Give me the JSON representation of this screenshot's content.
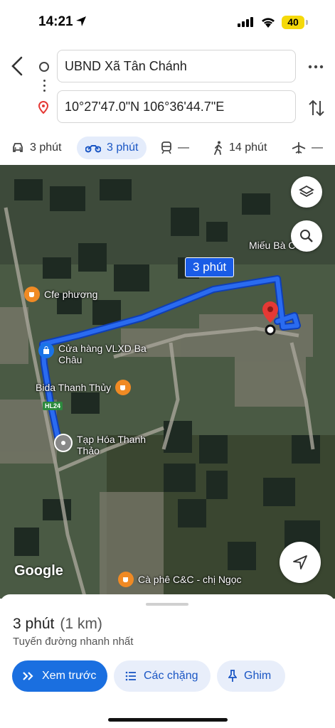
{
  "status": {
    "time": "14:21",
    "battery": "40"
  },
  "search": {
    "origin": "UBND Xã Tân Chánh",
    "destination": "10°27'47.0\"N 106°36'44.7\"E"
  },
  "modes": [
    {
      "label": "3 phút",
      "icon": "car-icon"
    },
    {
      "label": "3 phút",
      "icon": "motorbike-icon"
    },
    {
      "label": "—",
      "icon": "transit-icon"
    },
    {
      "label": "14 phút",
      "icon": "walk-icon"
    },
    {
      "label": "—",
      "icon": "flight-icon"
    }
  ],
  "map": {
    "route_badge": "3 phút",
    "road_label": "HL24",
    "attribution": "Google",
    "pois": {
      "mieu": "Miếu Bà Cố Xứ",
      "cafe_phuong": "Cfe phương",
      "vlxd": "Cửa hàng VLXD Ba",
      "vlxd2": "Châu",
      "bida": "Bida Thanh Thủy",
      "taphoa": "Tạp Hóa Thanh",
      "taphoa2": "Thảo",
      "caphe_cc": "Cà phê C&C - chị Ngọc"
    }
  },
  "sheet": {
    "duration": "3 phút",
    "distance": "(1 km)",
    "subtitle": "Tuyến đường nhanh nhất",
    "buttons": {
      "preview": "Xem trước",
      "steps": "Các chặng",
      "pin": "Ghim"
    }
  },
  "colors": {
    "route": "#1a5ce6",
    "primary_button": "#1a6fe0",
    "pin_red": "#e53935"
  }
}
